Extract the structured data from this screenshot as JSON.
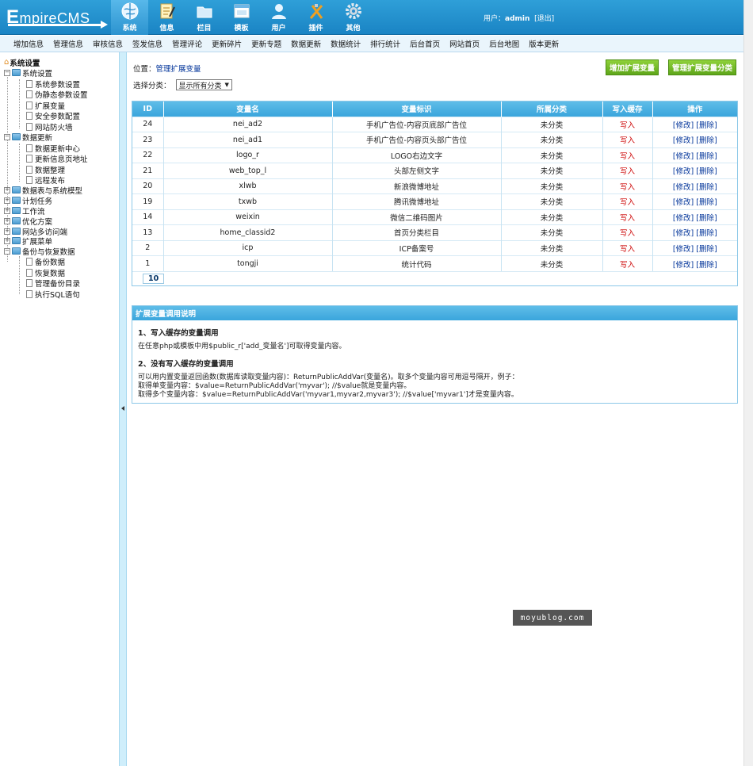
{
  "app": {
    "logo_big": "E",
    "logo_rest": "mpireCMS"
  },
  "nav": [
    {
      "label": "系统",
      "icon": "globe-icon"
    },
    {
      "label": "信息",
      "icon": "notepad-icon"
    },
    {
      "label": "栏目",
      "icon": "folder-icon"
    },
    {
      "label": "模板",
      "icon": "window-icon"
    },
    {
      "label": "用户",
      "icon": "person-icon"
    },
    {
      "label": "插件",
      "icon": "tools-icon"
    },
    {
      "label": "其他",
      "icon": "gear-icon"
    }
  ],
  "user": {
    "prefix": "用户：",
    "name": "admin",
    "logout": "[退出]"
  },
  "subnav": [
    "增加信息",
    "管理信息",
    "审核信息",
    "签发信息",
    "管理评论",
    "更新碎片",
    "更新专题",
    "数据更新",
    "数据统计",
    "排行统计",
    "后台首页",
    "网站首页",
    "后台地图",
    "版本更新"
  ],
  "tree": {
    "root": "系统设置",
    "g1": "系统设置",
    "g1_items": [
      "系统参数设置",
      "伪静态参数设置",
      "扩展变量",
      "安全参数配置",
      "网站防火墙"
    ],
    "g2": "数据更新",
    "g2_items": [
      "数据更新中心",
      "更新信息页地址",
      "数据整理",
      "远程发布"
    ],
    "groups": [
      "数据表与系统模型",
      "计划任务",
      "工作流",
      "优化方案",
      "网站多访问端",
      "扩展菜单"
    ],
    "g3": "备份与恢复数据",
    "g3_items": [
      "备份数据",
      "恢复数据",
      "管理备份目录",
      "执行SQL语句"
    ]
  },
  "location": {
    "prefix": "位置：",
    "link": "管理扩展变量"
  },
  "buttons": {
    "add": "增加扩展变量",
    "classes": "管理扩展变量分类"
  },
  "filter": {
    "label": "选择分类：",
    "selected": "显示所有分类"
  },
  "table": {
    "headers": [
      "ID",
      "变量名",
      "变量标识",
      "所属分类",
      "写入缓存",
      "操作"
    ],
    "rows": [
      {
        "id": "24",
        "name": "nei_ad2",
        "label": "手机广告位-内容页底部广告位",
        "cat": "未分类",
        "cache": "写入",
        "ops": "[修改] [删除]"
      },
      {
        "id": "23",
        "name": "nei_ad1",
        "label": "手机广告位-内容页头部广告位",
        "cat": "未分类",
        "cache": "写入",
        "ops": "[修改] [删除]"
      },
      {
        "id": "22",
        "name": "logo_r",
        "label": "LOGO右边文字",
        "cat": "未分类",
        "cache": "写入",
        "ops": "[修改] [删除]"
      },
      {
        "id": "21",
        "name": "web_top_l",
        "label": "头部左侧文字",
        "cat": "未分类",
        "cache": "写入",
        "ops": "[修改] [删除]"
      },
      {
        "id": "20",
        "name": "xlwb",
        "label": "新浪微博地址",
        "cat": "未分类",
        "cache": "写入",
        "ops": "[修改] [删除]"
      },
      {
        "id": "19",
        "name": "txwb",
        "label": "腾讯微博地址",
        "cat": "未分类",
        "cache": "写入",
        "ops": "[修改] [删除]"
      },
      {
        "id": "14",
        "name": "weixin",
        "label": "微信二维码图片",
        "cat": "未分类",
        "cache": "写入",
        "ops": "[修改] [删除]"
      },
      {
        "id": "13",
        "name": "home_classid2",
        "label": "首页分类栏目",
        "cat": "未分类",
        "cache": "写入",
        "ops": "[修改] [删除]"
      },
      {
        "id": "2",
        "name": "icp",
        "label": "ICP备案号",
        "cat": "未分类",
        "cache": "写入",
        "ops": "[修改] [删除]"
      },
      {
        "id": "1",
        "name": "tongji",
        "label": "统计代码",
        "cat": "未分类",
        "cache": "写入",
        "ops": "[修改] [删除]"
      }
    ],
    "pager": "10"
  },
  "help": {
    "title": "扩展变量调用说明",
    "h1": "1、写入缓存的变量调用",
    "t1": "在任意php或模板中用$public_r['add_变量名']可取得变量内容。",
    "h2": "2、没有写入缓存的变量调用",
    "t2": "可以用内置变量返回函数(数据库读取变量内容)：ReturnPublicAddVar(变量名)。取多个变量内容可用逗号隔开，例子：",
    "t3": "取得单变量内容：$value=ReturnPublicAddVar('myvar'); //$value就是变量内容。",
    "t4": "取得多个变量内容：$value=ReturnPublicAddVar('myvar1,myvar2,myvar3'); //$value['myvar1']才是变量内容。"
  },
  "watermark": "moyublog.com"
}
